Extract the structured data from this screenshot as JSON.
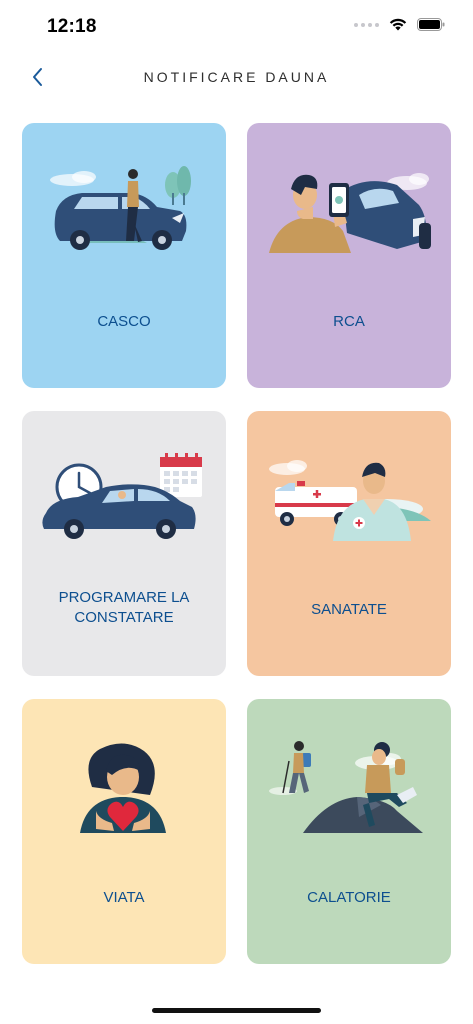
{
  "status_bar": {
    "time": "12:18"
  },
  "nav": {
    "title": "NOTIFICARE DAUNA"
  },
  "colors": {
    "casco": "#9dd4f2",
    "rca": "#c8b3da",
    "programare": "#e8e8ea",
    "sanatate": "#f5c6a0",
    "viata": "#fde5b5",
    "calatorie": "#bdd9bb",
    "label": "#0d4f8f"
  },
  "cards": [
    {
      "label": "CASCO",
      "icon": "car-accident-illustration"
    },
    {
      "label": "RCA",
      "icon": "phone-photo-car-illustration"
    },
    {
      "label": "PROGRAMARE LA CONSTATARE",
      "icon": "clock-calendar-car-illustration"
    },
    {
      "label": "SANATATE",
      "icon": "doctor-ambulance-illustration"
    },
    {
      "label": "VIATA",
      "icon": "woman-heart-illustration"
    },
    {
      "label": "CALATORIE",
      "icon": "hikers-illustration"
    }
  ]
}
